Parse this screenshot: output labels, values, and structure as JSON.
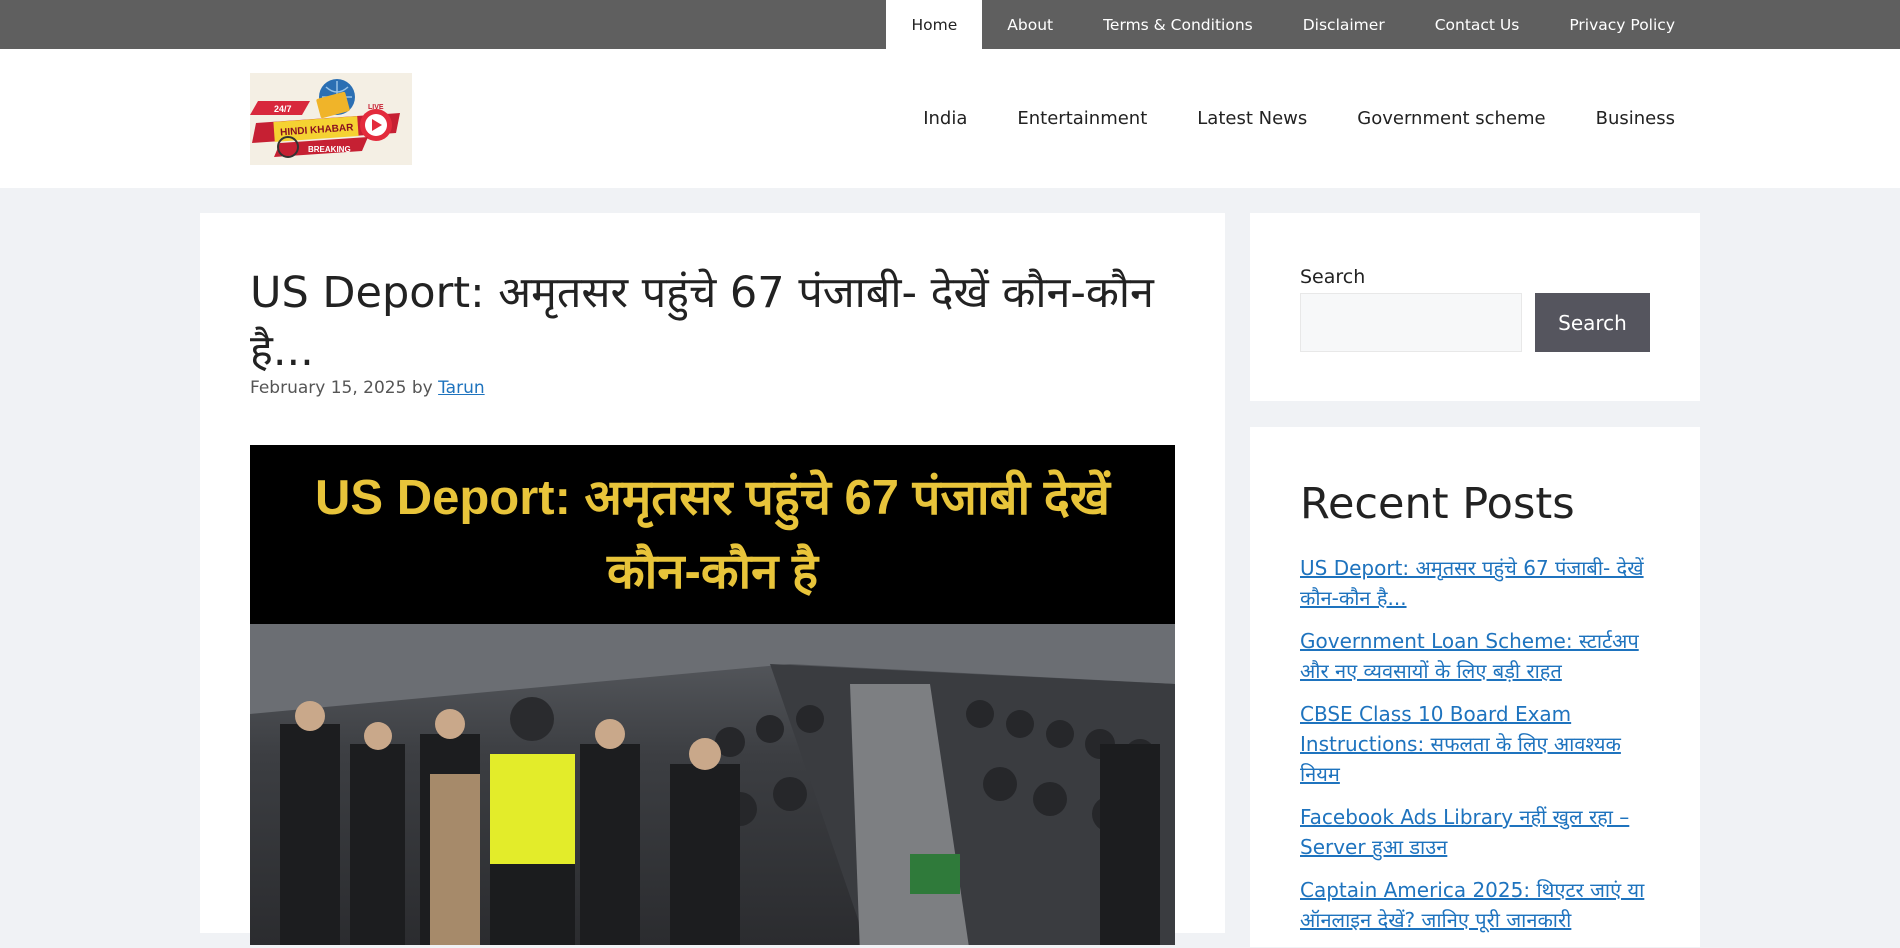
{
  "topnav": {
    "items": [
      "Home",
      "About",
      "Terms & Conditions",
      "Disclaimer",
      "Contact Us",
      "Privacy Policy"
    ],
    "active_index": 0
  },
  "logo": {
    "badge": "24/7",
    "live": "LIVE",
    "main": "HINDI KHABAR",
    "sub": "BREAKING"
  },
  "mainnav": {
    "items": [
      "India",
      "Entertainment",
      "Latest News",
      "Government scheme",
      "Business"
    ]
  },
  "article": {
    "title": "US Deport: अमृतसर पहुंचे 67 पंजाबी- देखें कौन-कौन है...",
    "date": "February 15, 2025",
    "by": "by",
    "author": "Tarun",
    "image_banner": "US Deport: अमृतसर पहुंचे 67 पंजाबी देखें कौन-कौन है"
  },
  "sidebar": {
    "search": {
      "label": "Search",
      "value": "",
      "button": "Search"
    },
    "recent": {
      "heading": "Recent Posts",
      "posts": [
        "US Deport: अमृतसर पहुंचे 67 पंजाबी- देखें कौन-कौन है...",
        "Government Loan Scheme: स्टार्टअप और नए व्यवसायों के लिए बड़ी राहत",
        "CBSE Class 10 Board Exam Instructions: सफलता के लिए आवश्यक नियम",
        "Facebook Ads Library नहीं खुल रहा – Server हुआ डाउन",
        "Captain America 2025: थिएटर जाएं या ऑनलाइन देखें? जानिए पूरी जानकारी"
      ]
    }
  },
  "colors": {
    "topbar": "#5f5f5f",
    "link": "#1e73be",
    "button": "#55555e",
    "banner_text": "#e8c43a",
    "page_bg": "#f0f2f5"
  }
}
